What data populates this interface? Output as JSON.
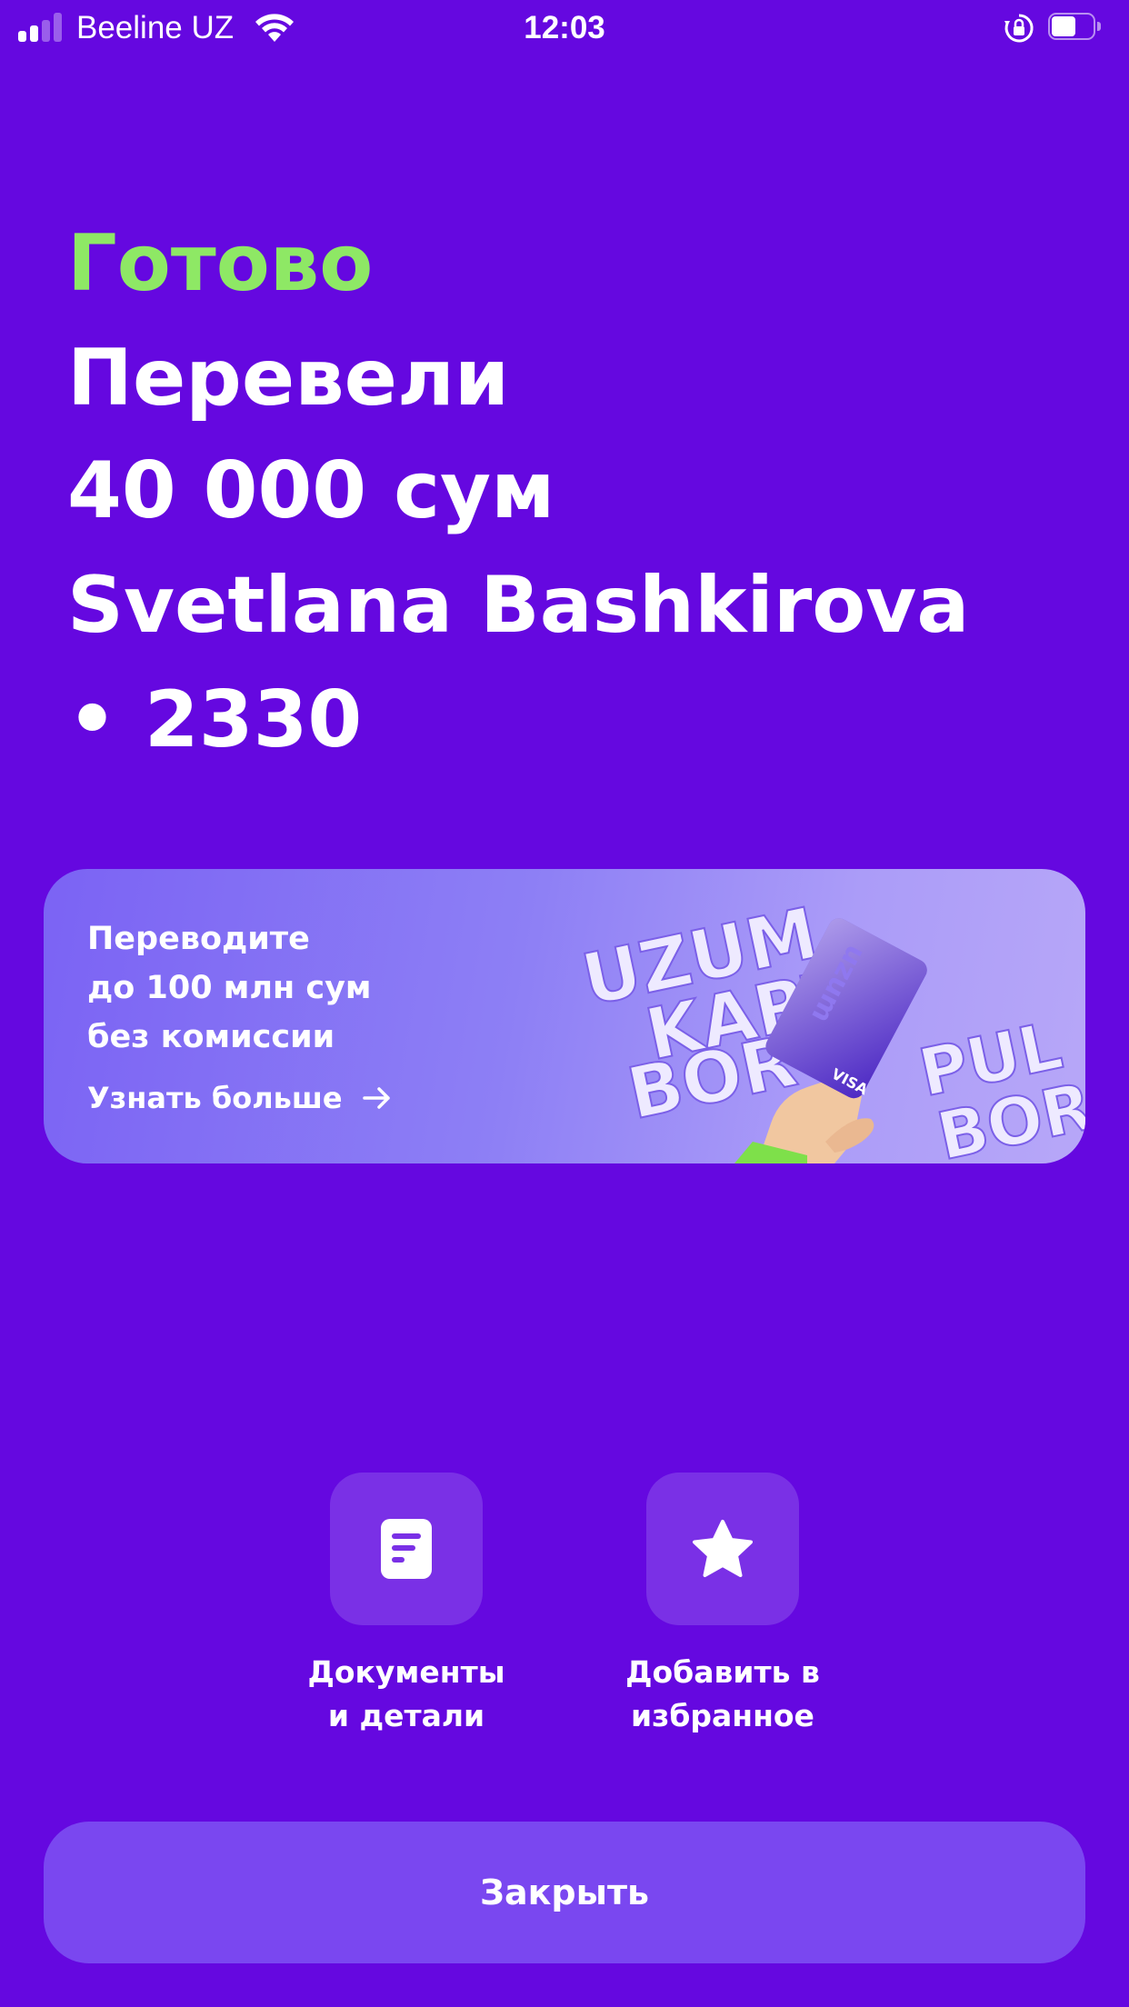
{
  "status_bar": {
    "carrier": "Beeline UZ",
    "time": "12:03",
    "signal_bars_active": 2,
    "battery_level": 0.45,
    "icons": [
      "signal-icon",
      "wifi-icon",
      "rotation-lock-icon",
      "battery-icon"
    ]
  },
  "result": {
    "status": "Готово",
    "action": "Перевели",
    "amount": "40 000 сум",
    "recipient": "Svetlana Bashkirova",
    "card": "• 2330"
  },
  "promo": {
    "line1": "Переводите",
    "line2": "до 100 млн сум",
    "line3": "без комиссии",
    "link": "Узнать больше",
    "art_words": [
      "UZUM",
      "KARTA",
      "BOR",
      "PUL",
      "BOR"
    ],
    "card_brand": "VISA",
    "card_logo": "uzum"
  },
  "actions": [
    {
      "line1": "Документы",
      "line2": "и детали",
      "icon": "document-icon"
    },
    {
      "line1": "Добавить в",
      "line2": "избранное",
      "icon": "star-icon"
    }
  ],
  "close_button": "Закрыть",
  "colors": {
    "background": "#6508e0",
    "accent_green": "#8ee865",
    "tile": "#7a30e6",
    "button": "#7a47f0"
  }
}
